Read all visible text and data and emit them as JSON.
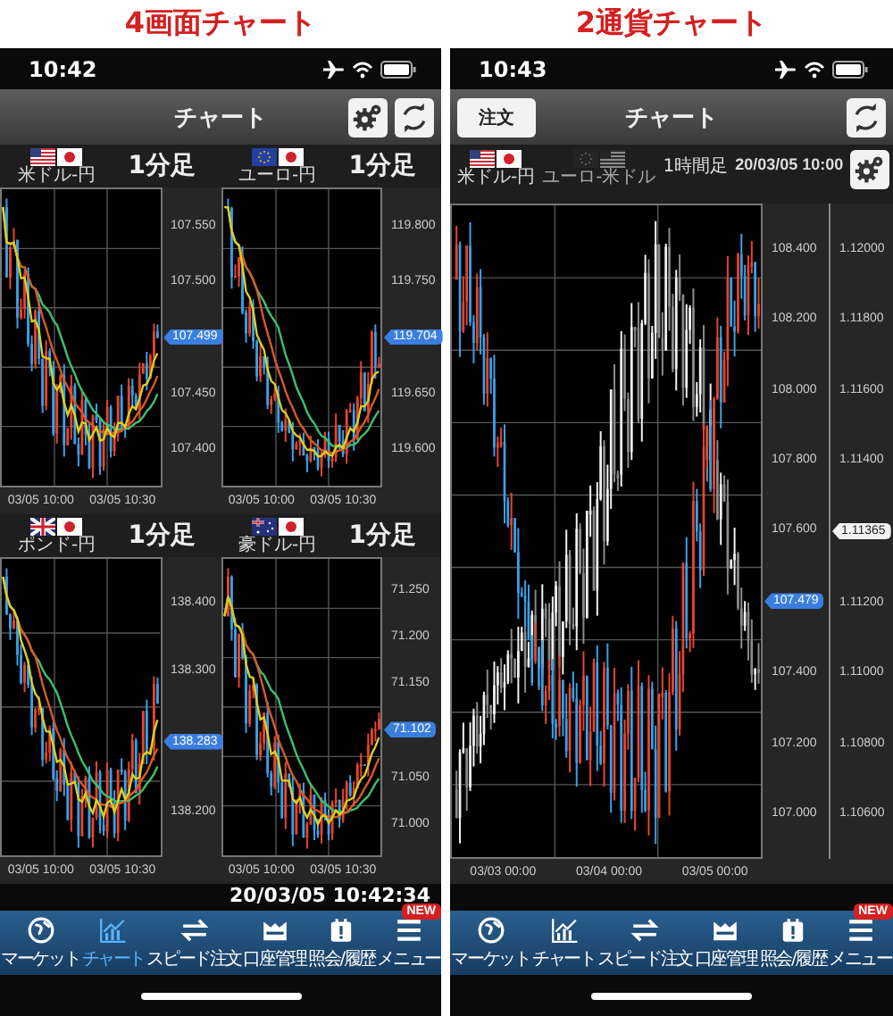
{
  "screens": [
    {
      "kind": "quad",
      "caption": "4画面チャート",
      "status_time": "10:42",
      "nav_title": "チャート",
      "panels": [
        {
          "pair": "米ドル-円",
          "interval": "1分足",
          "axis": [
            {
              "kind": "tick",
              "label": "107.550"
            },
            {
              "kind": "tick",
              "label": "107.500"
            },
            {
              "kind": "tag",
              "label": "107.499",
              "color": "#3a7ee0"
            },
            {
              "kind": "tick",
              "label": "107.450"
            },
            {
              "kind": "tick",
              "label": "107.400"
            }
          ],
          "times": [
            "03/05 10:00",
            "03/05 10:30"
          ]
        },
        {
          "pair": "ユーロ-円",
          "interval": "1分足",
          "axis": [
            {
              "kind": "tick",
              "label": "119.800"
            },
            {
              "kind": "tick",
              "label": "119.750"
            },
            {
              "kind": "tag",
              "label": "119.704",
              "color": "#3a7ee0"
            },
            {
              "kind": "tick",
              "label": "119.650"
            },
            {
              "kind": "tick",
              "label": "119.600"
            }
          ],
          "times": [
            "03/05 10:00",
            "03/05 10:30"
          ]
        },
        {
          "pair": "ポンド-円",
          "interval": "1分足",
          "axis": [
            {
              "kind": "tick",
              "label": "138.400"
            },
            {
              "kind": "tick",
              "label": "138.300"
            },
            {
              "kind": "tag",
              "label": "138.283",
              "color": "#3a7ee0"
            },
            {
              "kind": "tick",
              "label": "138.200"
            }
          ],
          "times": [
            "03/05 10:00",
            "03/05 10:30"
          ]
        },
        {
          "pair": "豪ドル-円",
          "interval": "1分足",
          "axis": [
            {
              "kind": "tick",
              "label": "71.250"
            },
            {
              "kind": "tick",
              "label": "71.200"
            },
            {
              "kind": "tick",
              "label": "71.150"
            },
            {
              "kind": "tag",
              "label": "71.102",
              "color": "#3a7ee0"
            },
            {
              "kind": "tick",
              "label": "71.050"
            },
            {
              "kind": "tick",
              "label": "71.000"
            }
          ],
          "times": [
            "03/05 10:00",
            "03/05 10:30"
          ]
        }
      ],
      "timestamp": "20/03/05 10:42:34",
      "tabs": [
        {
          "label": "マーケット",
          "selected": false
        },
        {
          "label": "チャート",
          "selected": true
        },
        {
          "label": "スピード注文",
          "selected": false
        },
        {
          "label": "口座管理",
          "selected": false
        },
        {
          "label": "照会/履歴",
          "selected": false
        },
        {
          "label": "メニュー",
          "selected": false,
          "badge": "NEW"
        }
      ]
    },
    {
      "kind": "dual",
      "caption": "2通貨チャート",
      "status_time": "10:43",
      "nav_title": "チャート",
      "order_button": "注文",
      "pairs": [
        {
          "label": "米ドル-円",
          "selected": true
        },
        {
          "label": "ユーロ-米ドル",
          "selected": false
        }
      ],
      "interval": "1時間足",
      "datetime": "20/03/05 10:00",
      "axis_1": [
        {
          "kind": "tick",
          "label": "108.400"
        },
        {
          "kind": "tick",
          "label": "108.200"
        },
        {
          "kind": "tick",
          "label": "108.000"
        },
        {
          "kind": "tick",
          "label": "107.800"
        },
        {
          "kind": "tick",
          "label": "107.600"
        },
        {
          "kind": "tag",
          "label": "107.479",
          "color": "#3a7ee0"
        },
        {
          "kind": "tick",
          "label": "107.400"
        },
        {
          "kind": "tick",
          "label": "107.200"
        },
        {
          "kind": "tick",
          "label": "107.000"
        }
      ],
      "axis_2": [
        {
          "kind": "tick",
          "label": "1.12000"
        },
        {
          "kind": "tick",
          "label": "1.11800"
        },
        {
          "kind": "tick",
          "label": "1.11600"
        },
        {
          "kind": "tick",
          "label": "1.11400"
        },
        {
          "kind": "tag",
          "label": "1.11365",
          "color": "#f2f2f2"
        },
        {
          "kind": "tick",
          "label": "1.11200"
        },
        {
          "kind": "tick",
          "label": "1.11000"
        },
        {
          "kind": "tick",
          "label": "1.10800"
        },
        {
          "kind": "tick",
          "label": "1.10600"
        }
      ],
      "times": [
        "03/03 00:00",
        "03/04 00:00",
        "03/05 00:00"
      ],
      "tabs": [
        {
          "label": "マーケット",
          "selected": false
        },
        {
          "label": "チャート",
          "selected": false
        },
        {
          "label": "スピード注文",
          "selected": false
        },
        {
          "label": "口座管理",
          "selected": false
        },
        {
          "label": "照会/履歴",
          "selected": false
        },
        {
          "label": "メニュー",
          "selected": false,
          "badge": "NEW"
        }
      ]
    }
  ]
}
